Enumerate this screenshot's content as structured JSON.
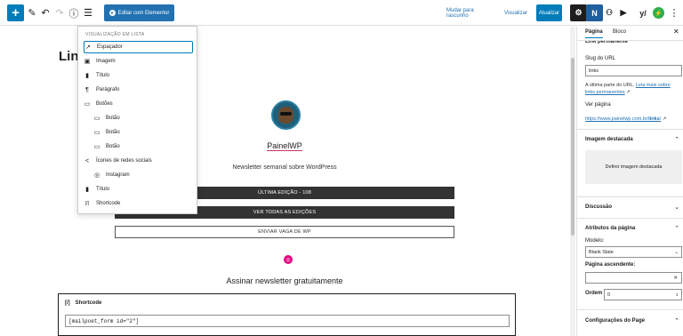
{
  "toolbar": {
    "plus_label": "+",
    "elementor_label": "Editar com Elementor",
    "save_draft": "Mudar para rascunho",
    "preview": "Visualizar",
    "update": "Atualizar"
  },
  "listview": {
    "title": "VISUALIZAÇÃO EM LISTA",
    "items": [
      {
        "label": "Espaçador",
        "icon": "↗"
      },
      {
        "label": "Imagem",
        "icon": "▣"
      },
      {
        "label": "Título",
        "icon": "▮"
      },
      {
        "label": "Parágrafo",
        "icon": "¶"
      },
      {
        "label": "Botões",
        "icon": "▭"
      },
      {
        "label": "Botão",
        "icon": "▭"
      },
      {
        "label": "Botão",
        "icon": "▭"
      },
      {
        "label": "Botão",
        "icon": "▭"
      },
      {
        "label": "Ícones de redes sociais",
        "icon": "<"
      },
      {
        "label": "Instagram",
        "icon": "◎"
      },
      {
        "label": "Título",
        "icon": "▮"
      },
      {
        "label": "Shortcode",
        "icon": "[/]"
      }
    ]
  },
  "canvas": {
    "page_title": "Link",
    "site_name": "PainelWP",
    "tagline": "Newsletter semanal sobre WordPress",
    "buttons": [
      "ÚLTIMA EDIÇÃO - 108",
      "VER TODAS AS EDIÇÕES",
      "ENVIAR VAGA DE WP"
    ],
    "subscribe_heading": "Assinar newsletter gratuitamente",
    "shortcode_label": "Shortcode",
    "shortcode_value": "[mailpoet_form id=\"2\"]"
  },
  "sidebar": {
    "tabs": [
      "Página",
      "Bloco"
    ],
    "partial_heading": "Link permanente",
    "slug_label": "Slug do URL",
    "slug_value": "links",
    "slug_help_1": "A última parte do URL.",
    "slug_help_link": "Leia mais sobre links permanentes",
    "view_page_label": "Ver página",
    "view_page_url_prefix": "https://www.painelwp.com.br/",
    "view_page_url_slug": "links",
    "view_page_url_suffix": "/",
    "featured_section": "Imagem destacada",
    "featured_button": "Definir imagem destacada",
    "discussion_section": "Discussão",
    "attributes_section": "Atributos da página",
    "model_label": "Modelo:",
    "model_value": "Blank Slate",
    "parent_label": "Página ascendente:",
    "order_label": "Ordem",
    "order_value": "0",
    "page_settings_section": "Configurações do Page"
  }
}
